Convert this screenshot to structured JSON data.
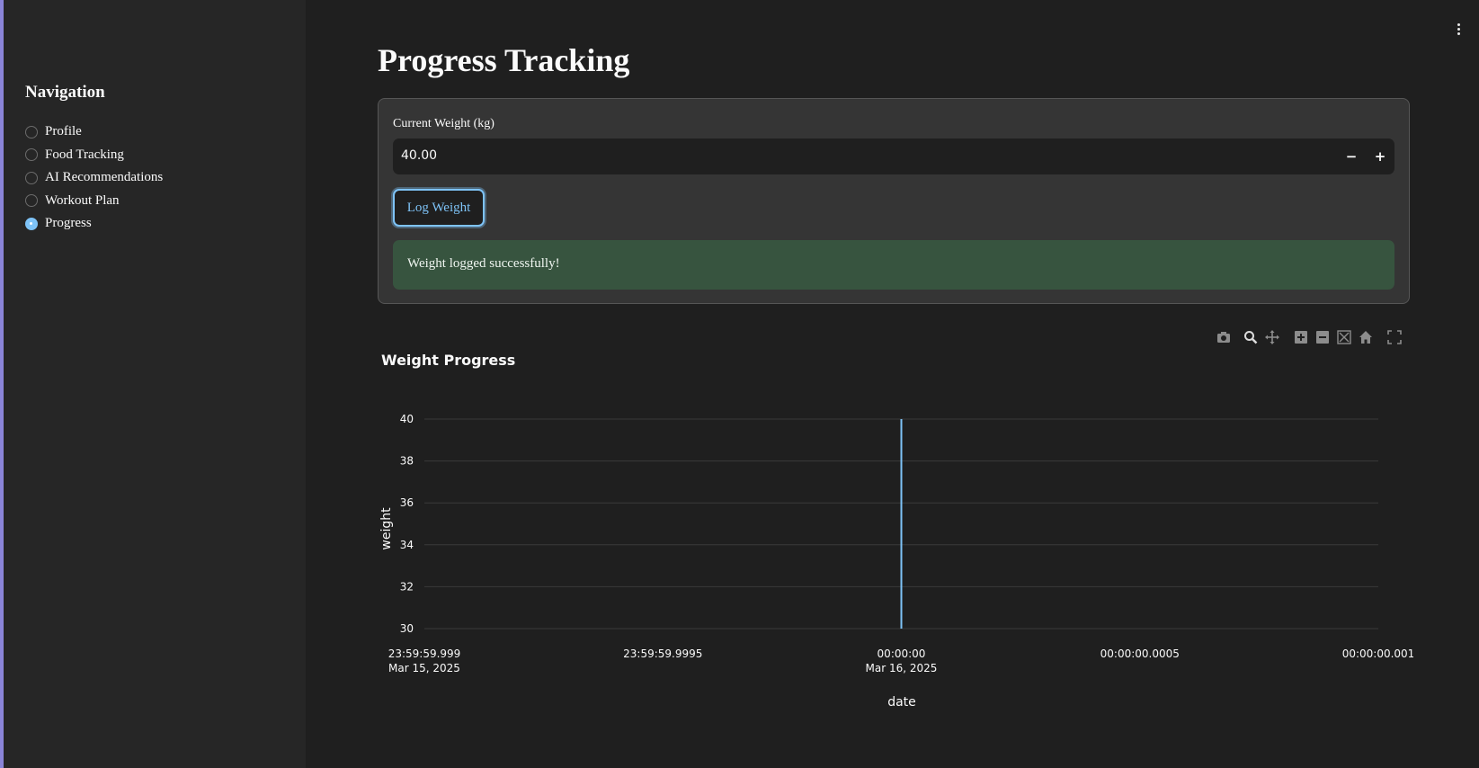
{
  "sidebar": {
    "title": "Navigation",
    "items": [
      {
        "label": "Profile",
        "checked": false
      },
      {
        "label": "Food Tracking",
        "checked": false
      },
      {
        "label": "AI Recommendations",
        "checked": false
      },
      {
        "label": "Workout Plan",
        "checked": false
      },
      {
        "label": "Progress",
        "checked": true
      }
    ]
  },
  "main": {
    "title": "Progress Tracking",
    "form": {
      "label": "Current Weight (kg)",
      "value": "40.00",
      "minus": "−",
      "plus": "+",
      "button": "Log Weight",
      "success": "Weight logged successfully!"
    }
  },
  "toolbar": {
    "icons": [
      "camera-icon",
      "zoom-icon",
      "pan-icon",
      "zoom-in-icon",
      "zoom-out-icon",
      "autoscale-icon",
      "reset-axes-icon",
      "fullscreen-icon"
    ]
  },
  "colors": {
    "accent": "#7ec3f7",
    "success_bg": "#37543f",
    "line": "#7ec3f7"
  },
  "chart_data": {
    "type": "line",
    "title": "Weight Progress",
    "xlabel": "date",
    "ylabel": "weight",
    "ylim": [
      30,
      40
    ],
    "yticks": [
      30,
      32,
      34,
      36,
      38,
      40
    ],
    "xticks": [
      {
        "line1": "23:59:59.999",
        "line2": "Mar 15, 2025"
      },
      {
        "line1": "23:59:59.9995",
        "line2": ""
      },
      {
        "line1": "00:00:00",
        "line2": "Mar 16, 2025"
      },
      {
        "line1": "00:00:00.0005",
        "line2": ""
      },
      {
        "line1": "00:00:00.001",
        "line2": ""
      }
    ],
    "series": [
      {
        "x": [
          "2025-03-16 00:00:00",
          "2025-03-16 00:00:00"
        ],
        "values": [
          30,
          40
        ]
      }
    ],
    "grid": true
  }
}
